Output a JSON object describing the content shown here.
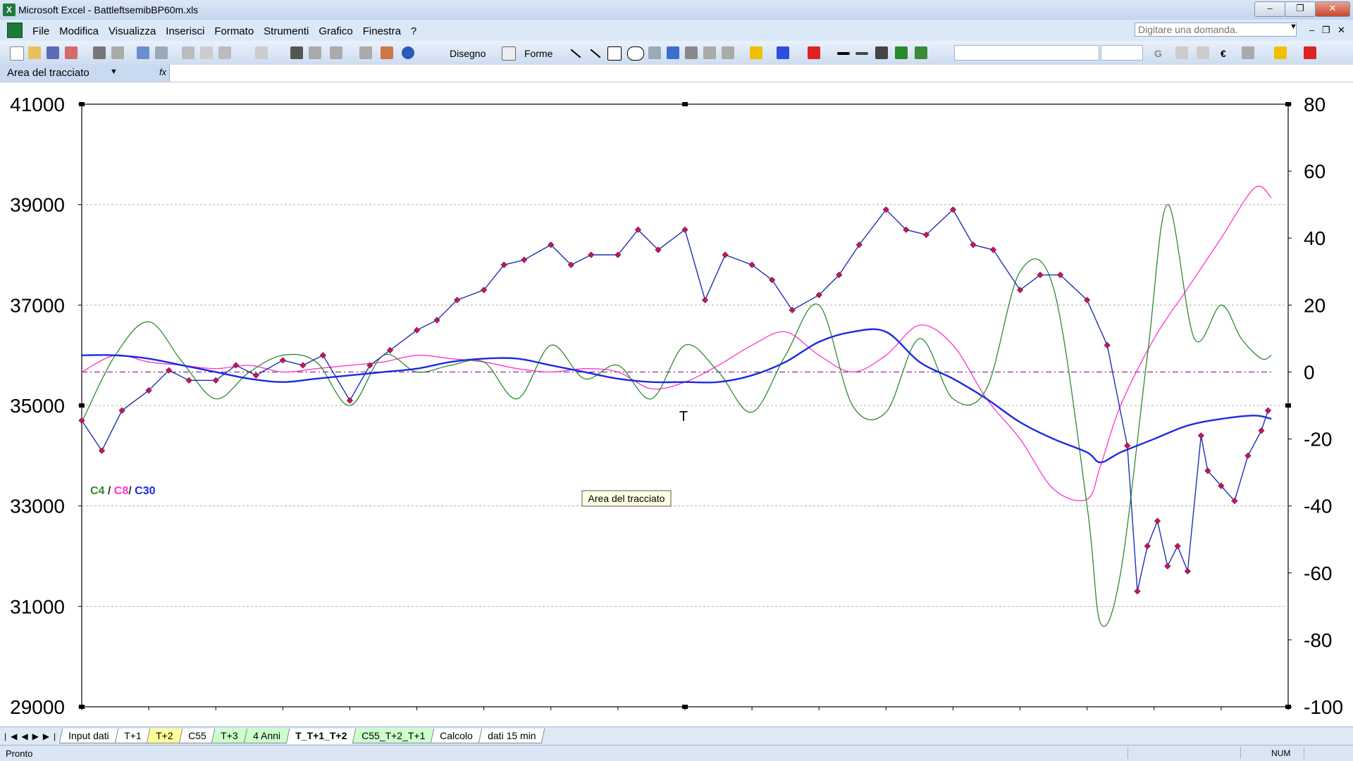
{
  "window": {
    "title": "Microsoft Excel - BattleftsemibBP60m.xls"
  },
  "menu": [
    "File",
    "Modifica",
    "Visualizza",
    "Inserisci",
    "Formato",
    "Strumenti",
    "Grafico",
    "Finestra",
    "?"
  ],
  "help_box": {
    "placeholder": "Digitare una domanda."
  },
  "toolbar": {
    "disegno": "Disegno",
    "forme": "Forme",
    "bold": "G",
    "euro": "€"
  },
  "name_box": {
    "value": "Area del tracciato",
    "fx": "fx"
  },
  "tooltip": "Area del tracciato",
  "sheet_tabs": [
    {
      "label": "Input dati",
      "color": "white"
    },
    {
      "label": "T+1",
      "color": "white"
    },
    {
      "label": "T+2",
      "color": "yellow"
    },
    {
      "label": "C55",
      "color": "white"
    },
    {
      "label": "T+3",
      "color": "green"
    },
    {
      "label": "4 Anni",
      "color": "green"
    },
    {
      "label": "T_T+1_T+2",
      "color": "white",
      "active": true
    },
    {
      "label": "C55_T+2_T+1",
      "color": "green"
    },
    {
      "label": "Calcolo",
      "color": "white"
    },
    {
      "label": "dati 15 min",
      "color": "white"
    }
  ],
  "status": {
    "left": "Pronto",
    "num": "NUM"
  },
  "colors": {
    "price": "#1f2fb8",
    "marker": "#c0185a",
    "c4": "#2e8b2e",
    "c8": "#ff33cc",
    "c30": "#1a2be0",
    "zero_line": "#8a1a8a"
  },
  "chart_data": {
    "type": "line",
    "legend": [
      {
        "name": "C4",
        "color": "#2e8b2e"
      },
      {
        "name": "C8",
        "color": "#ff33cc"
      },
      {
        "name": "C30",
        "color": "#1a2be0"
      }
    ],
    "legend_separators": [
      "/",
      "/"
    ],
    "annotation": "T",
    "y_left": {
      "ylim": [
        29000,
        41000
      ],
      "ticks": [
        29000,
        31000,
        33000,
        35000,
        37000,
        39000,
        41000
      ]
    },
    "y_right": {
      "ylim": [
        -100,
        80
      ],
      "ticks": [
        -100,
        -80,
        -60,
        -40,
        -20,
        0,
        20,
        40,
        60,
        80
      ]
    },
    "x_count": 18,
    "price_series": {
      "name": "",
      "axis": "left",
      "x": [
        0,
        0.3,
        0.6,
        1,
        1.3,
        1.6,
        2,
        2.3,
        2.6,
        3,
        3.3,
        3.6,
        4,
        4.3,
        4.6,
        5,
        5.3,
        5.6,
        6,
        6.3,
        6.6,
        7,
        7.3,
        7.6,
        8,
        8.3,
        8.6,
        9,
        9.3,
        9.6,
        10,
        10.3,
        10.6,
        11,
        11.3,
        11.6,
        12,
        12.3,
        12.6,
        13,
        13.3,
        13.6,
        14,
        14.3,
        14.6,
        15,
        15.3,
        15.6,
        15.75,
        15.9,
        16.05,
        16.2,
        16.35,
        16.5,
        16.7,
        16.8,
        17,
        17.2,
        17.4,
        17.6,
        17.7
      ],
      "values": [
        34700,
        34100,
        34900,
        35300,
        35700,
        35500,
        35500,
        35800,
        35600,
        35900,
        35800,
        36000,
        35100,
        35800,
        36100,
        36500,
        36700,
        37100,
        37300,
        37800,
        37900,
        38200,
        37800,
        38000,
        38000,
        38500,
        38100,
        38500,
        37100,
        38000,
        37800,
        37500,
        36900,
        37200,
        37600,
        38200,
        38900,
        38500,
        38400,
        38900,
        38200,
        38100,
        37300,
        37600,
        37600,
        37100,
        36200,
        34200,
        31300,
        32200,
        32700,
        31800,
        32200,
        31700,
        34400,
        33700,
        33400,
        33100,
        34000,
        34500,
        34900
      ]
    },
    "c4_series": {
      "name": "C4",
      "axis": "right",
      "x": [
        0,
        0.5,
        1,
        1.5,
        2,
        2.5,
        3,
        3.5,
        4,
        4.5,
        5,
        5.5,
        6,
        6.5,
        7,
        7.5,
        8,
        8.5,
        9,
        9.5,
        10,
        10.5,
        11,
        11.5,
        12,
        12.5,
        13,
        13.5,
        14,
        14.5,
        15,
        15.2,
        15.5,
        15.9,
        16.2,
        16.6,
        17,
        17.3,
        17.6,
        17.75
      ],
      "values": [
        -15,
        5,
        15,
        3,
        -8,
        0,
        5,
        3,
        -10,
        5,
        0,
        2,
        3,
        -8,
        8,
        -2,
        2,
        -8,
        8,
        0,
        -12,
        5,
        20,
        -10,
        -12,
        10,
        -8,
        -5,
        30,
        25,
        -40,
        -75,
        -60,
        5,
        50,
        10,
        20,
        10,
        4,
        5
      ]
    },
    "c8_series": {
      "name": "C8",
      "axis": "right",
      "x": [
        0,
        0.5,
        1,
        1.5,
        2,
        2.5,
        3,
        3.5,
        4,
        4.5,
        5,
        5.5,
        6,
        6.5,
        7,
        7.5,
        8,
        8.5,
        9,
        9.5,
        10,
        10.5,
        11,
        11.5,
        12,
        12.5,
        13,
        13.5,
        14,
        14.5,
        15,
        15.2,
        15.5,
        16,
        16.5,
        17,
        17.5,
        17.75
      ],
      "values": [
        0,
        5,
        3,
        2,
        1,
        2,
        0,
        1,
        2,
        3,
        5,
        4,
        3,
        1,
        0,
        1,
        0,
        -5,
        -3,
        2,
        8,
        12,
        5,
        0,
        5,
        14,
        8,
        -8,
        -20,
        -35,
        -38,
        -28,
        -10,
        10,
        25,
        40,
        55,
        52
      ]
    },
    "c30_series": {
      "name": "C30",
      "axis": "right",
      "x": [
        0,
        0.5,
        1,
        1.5,
        2,
        2.5,
        3,
        3.5,
        4,
        4.5,
        5,
        5.5,
        6,
        6.5,
        7,
        7.5,
        8,
        8.5,
        9,
        9.5,
        10,
        10.5,
        11,
        11.5,
        12,
        12.5,
        13,
        13.5,
        14,
        14.5,
        15,
        15.2,
        15.5,
        16,
        16.5,
        17,
        17.5,
        17.75
      ],
      "values": [
        5,
        5,
        4,
        2,
        0,
        -2,
        -3,
        -2,
        -1,
        0,
        1,
        3,
        4,
        4,
        2,
        0,
        -2,
        -3,
        -3,
        -3,
        -1,
        3,
        9,
        12,
        12,
        3,
        -2,
        -8,
        -15,
        -20,
        -24,
        -27,
        -24,
        -20,
        -16,
        -14,
        -13,
        -14
      ]
    },
    "zero_line": {
      "axis": "right",
      "value": 0,
      "style": "dash-dot"
    }
  }
}
